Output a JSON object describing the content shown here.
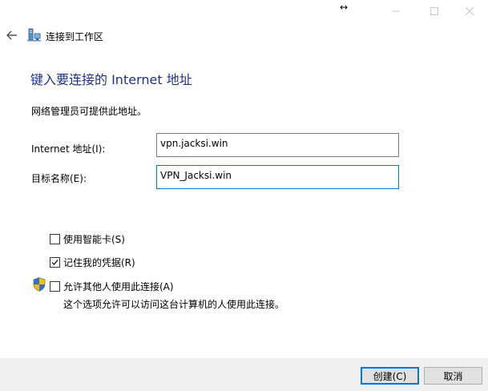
{
  "window": {
    "title": "连接到工作区",
    "resize_cursor": "↔",
    "minimize_glyph": "—",
    "maximize_glyph": "☐",
    "close_glyph": "✕"
  },
  "page": {
    "heading": "键入要连接的 Internet 地址",
    "info": "网络管理员可提供此地址。"
  },
  "form": {
    "internet_address_label": "Internet 地址(I):",
    "internet_address_value": "vpn.jacksi.win",
    "destination_name_label": "目标名称(E):",
    "destination_name_value": "VPN_Jacksi.win"
  },
  "options": {
    "smart_card_label": "使用智能卡(S)",
    "smart_card_checked": false,
    "remember_label": "记住我的凭据(R)",
    "remember_checked": true,
    "allow_others_label": "允许其他人使用此连接(A)",
    "allow_others_checked": false,
    "allow_others_desc": "这个选项允许可以访问这台计算机的人使用此连接。"
  },
  "buttons": {
    "create": "创建(C)",
    "cancel": "取消"
  },
  "icons": {
    "back": "back-arrow-icon",
    "app": "network-connection-icon",
    "shield": "uac-shield-icon"
  },
  "colors": {
    "heading": "#1e3287",
    "focus_border": "#0078d7",
    "footer_bg": "#f0f0f0"
  }
}
